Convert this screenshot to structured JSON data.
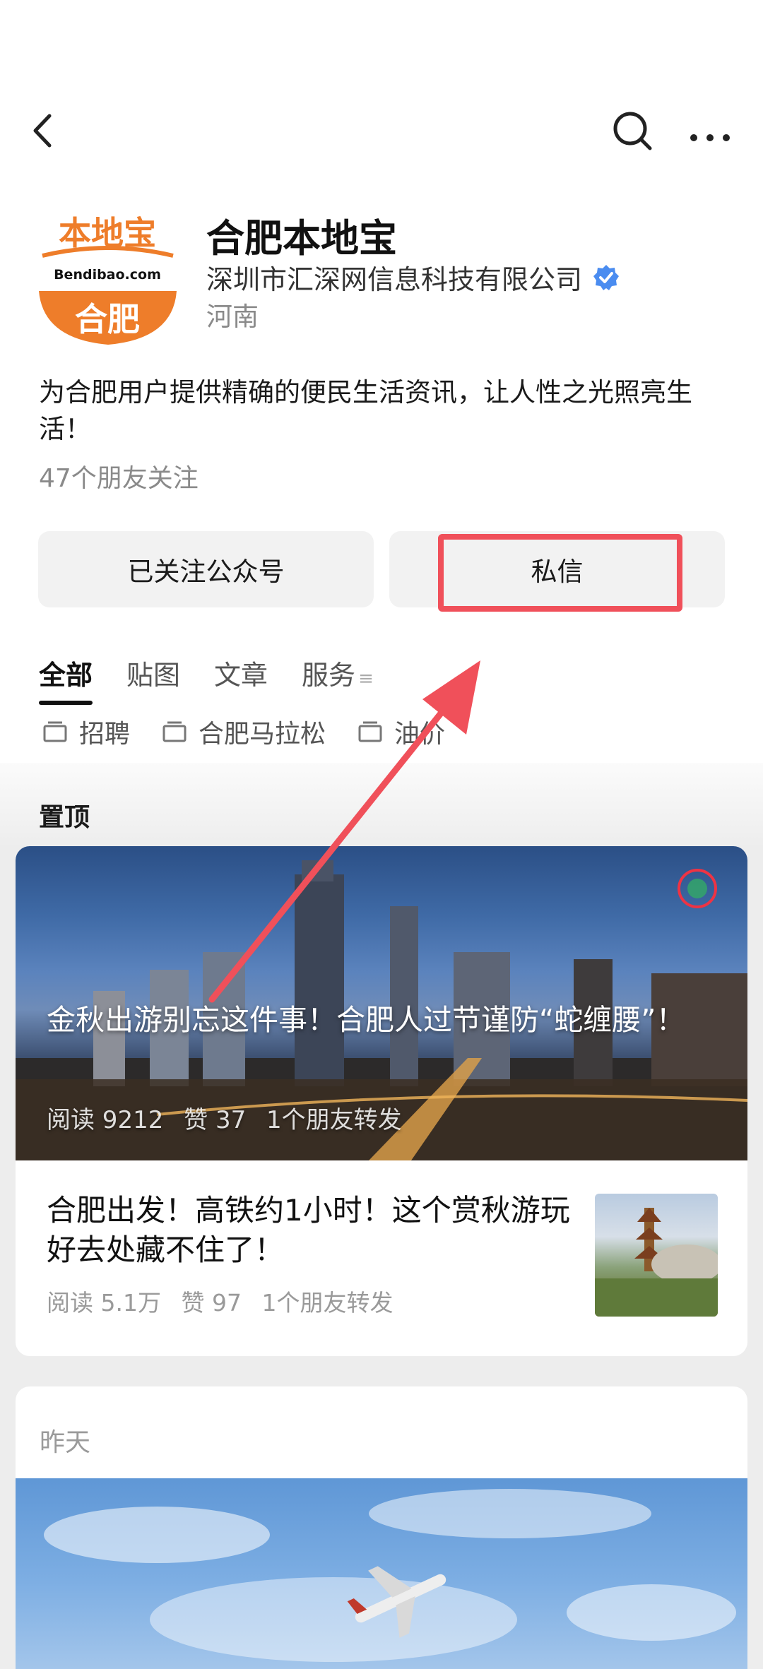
{
  "nav": {
    "back_icon": "chevron-left-icon",
    "search_icon": "search-icon",
    "more_icon": "more-dots-icon"
  },
  "profile": {
    "logo_text_top": "本地宝",
    "logo_text_mid": "Bendibao.com",
    "logo_text_bottom": "合肥",
    "name": "合肥本地宝",
    "company": "深圳市汇深网信息科技有限公司",
    "region": "河南",
    "description": "为合肥用户提供精确的便民生活资讯，让人性之光照亮生活！",
    "friends_following": "47个朋友关注",
    "colors": {
      "logo_orange": "#ee7d2a",
      "verified_blue": "#4a8cf0",
      "highlight_red": "#f0505a"
    }
  },
  "actions": {
    "follow_label": "已关注公众号",
    "message_label": "私信"
  },
  "tabs": [
    {
      "label": "全部",
      "active": true
    },
    {
      "label": "贴图",
      "active": false
    },
    {
      "label": "文章",
      "active": false
    },
    {
      "label": "服务",
      "active": false
    }
  ],
  "tabs_more_symbol": "≡",
  "chips": [
    {
      "label": "招聘",
      "icon": "folder-icon"
    },
    {
      "label": "合肥马拉松",
      "icon": "folder-icon"
    },
    {
      "label": "油价",
      "icon": "folder-icon"
    }
  ],
  "pinned": {
    "label": "置顶",
    "hero": {
      "title": "金秋出游别忘这件事！合肥人过节谨防“蛇缠腰”！",
      "reads": "阅读 9212",
      "likes": "赞 37",
      "shares": "1个朋友转发"
    },
    "article": {
      "title": "合肥出发！高铁约1小时！这个赏秋游玩好去处藏不住了！",
      "reads": "阅读 5.1万",
      "likes": "赞 97",
      "shares": "1个朋友转发"
    }
  },
  "section2": {
    "date_label": "昨天"
  }
}
